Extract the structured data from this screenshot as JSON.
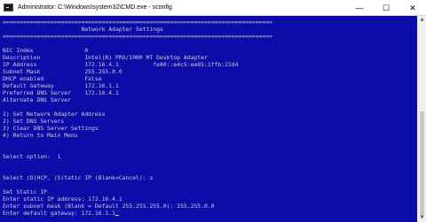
{
  "window": {
    "title": "Administrator: C:\\Windows\\system32\\CMD.exe - sconfig",
    "minimize_glyph": "—",
    "maximize_glyph": "☐",
    "close_glyph": "✕",
    "icon": "cmd-icon"
  },
  "console": {
    "lines": [
      "===============================================================================",
      "                       Network Adapter Settings",
      "===============================================================================",
      "",
      "NIC Index               0",
      "Description             Intel(R) PRO/1000 MT Desktop Adapter",
      "IP Address              172.16.4.1          fe80::e4c5:ee85:1ffb:21d4",
      "Subnet Mask             255.255.0.0",
      "DHCP enabled            False",
      "Default Gateway         172.16.1.1",
      "Preferred DNS Server    172.16.4.1",
      "Alternate DNS Server",
      "",
      "1) Set Network Adapter Address",
      "2) Set DNS Servers",
      "3) Clear DNS Server Settings",
      "4) Return to Main Menu",
      "",
      "",
      "Select option:  1",
      "",
      "",
      "Select (D)HCP, (S)tatic IP (Blank=Cancel): s",
      "",
      "Set Static IP",
      "Enter static IP address: 172.16.4.1",
      "Enter subnet mask (Blank = Default 255.255.255.0): 255.255.0.0",
      "Enter default gateway: 172.16.1.1"
    ]
  },
  "scrollbar": {
    "up_glyph": "▲",
    "down_glyph": "▼"
  }
}
